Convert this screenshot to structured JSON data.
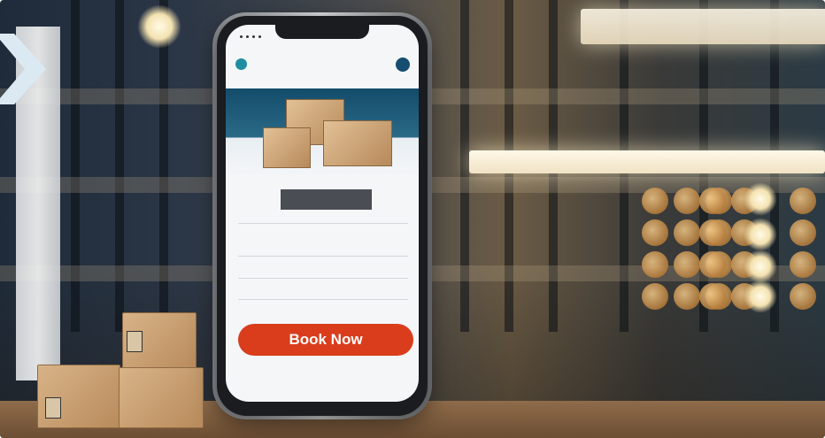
{
  "screen": {
    "caption": "",
    "rows": [
      {
        "label": "",
        "value": "",
        "extra": ""
      },
      {
        "label": "",
        "value": "",
        "extra": ""
      },
      {
        "label": "",
        "value": "",
        "extra": ""
      }
    ],
    "cta_label": "Book Now"
  },
  "colors": {
    "cta": "#d93d1c",
    "hero": "#134c6b",
    "accent_icon": "#1f8ea0"
  }
}
